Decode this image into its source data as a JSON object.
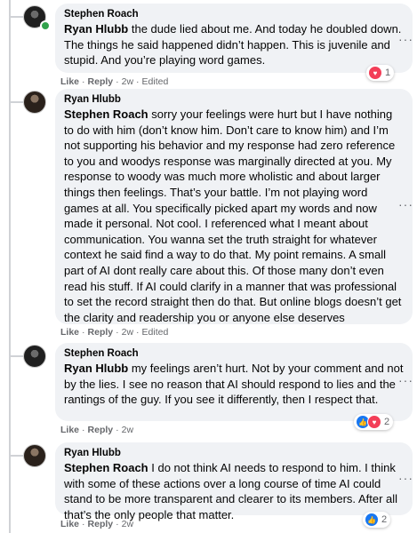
{
  "comments": [
    {
      "author": "Stephen Roach",
      "mention": "Ryan Hlubb",
      "text": " the dude lied about me. And today he doubled down. The things he said happened didn’t happen. This is juvenile and stupid. And you’re playing word games.",
      "like": "Like",
      "reply": "Reply",
      "time": "2w",
      "edited": "Edited",
      "reactions": {
        "icons": [
          "love-icon"
        ],
        "count": "1"
      }
    },
    {
      "author": "Ryan Hlubb",
      "mention": "Stephen Roach",
      "text": " sorry your feelings were hurt but I have nothing to do with him (don’t know him. Don’t care to know him) and I’m not supporting his behavior and my response had zero reference to you and woodys response was marginally directed at you. My response to woody was much more wholistic and about larger things then feelings. That’s your battle. I’m not playing word games at all. You specifically picked apart my words and now made it personal. Not cool. I referenced what I meant about communication. You wanna set the truth straight for whatever context he said find a way to do that. My point remains. A small part of AI dont really care about this. Of those many don’t even read his stuff. If AI could clarify in a manner that was professional to set the record straight then do that. But online blogs doesn’t get the clarity and readership you or anyone else deserves",
      "like": "Like",
      "reply": "Reply",
      "time": "2w",
      "edited": "Edited"
    },
    {
      "author": "Stephen Roach",
      "mention": "Ryan Hlubb",
      "text": " my feelings aren’t hurt. Not by your comment and not by the lies. I see no reason that AI should respond to lies and the rantings of the guy. If you see it differently, then I respect that.",
      "like": "Like",
      "reply": "Reply",
      "time": "2w",
      "reactions": {
        "icons": [
          "like-icon",
          "love-icon"
        ],
        "count": "2"
      }
    },
    {
      "author": "Ryan Hlubb",
      "mention": "Stephen Roach",
      "text": " I do not think AI needs to respond to him. I think with some of these actions over a long course of time AI could stand to be more transparent and clearer to its members. After all that’s the only people that matter.",
      "like": "Like",
      "reply": "Reply",
      "time": "2w",
      "reactions": {
        "icons": [
          "like-icon"
        ],
        "count": "2"
      }
    }
  ],
  "glyphs": {
    "more": "···",
    "dot": "·",
    "like_glyph": "👍",
    "love_glyph": "♥"
  }
}
